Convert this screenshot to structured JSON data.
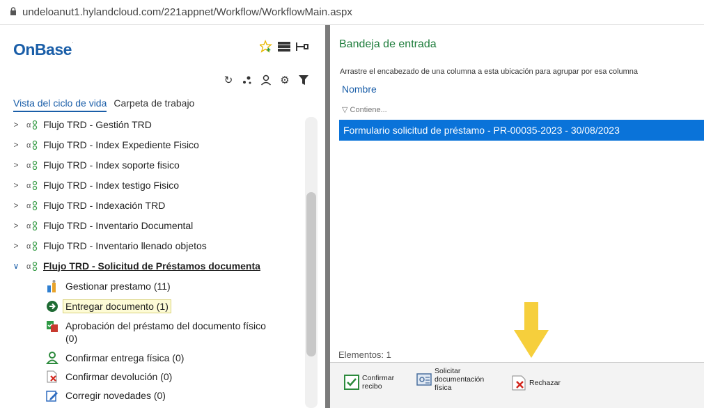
{
  "browser": {
    "url": "undeloanut1.hylandcloud.com/221appnet/Workflow/WorkflowMain.aspx"
  },
  "left": {
    "logo": "OnBase",
    "top_icons": [
      "star-add-icon",
      "layout-icon",
      "pin-icon"
    ],
    "tool_icons": [
      "refresh-icon",
      "dots-icon",
      "user-icon",
      "gear-icon",
      "filter-icon"
    ],
    "tabs": [
      {
        "label": "Vista del ciclo de vida",
        "active": true
      },
      {
        "label": "Carpeta de trabajo",
        "active": false
      }
    ],
    "tree": [
      {
        "label": "Flujo TRD - Gestión TRD"
      },
      {
        "label": "Flujo TRD - Index Expediente Fisico"
      },
      {
        "label": "Flujo TRD - Index soporte fisico"
      },
      {
        "label": "Flujo TRD - Index testigo Fisico"
      },
      {
        "label": "Flujo TRD - Indexación TRD"
      },
      {
        "label": "Flujo TRD - Inventario Documental"
      },
      {
        "label": "Flujo TRD - Inventario llenado objetos"
      },
      {
        "label": "Flujo TRD - Solicitud de Préstamos documenta"
      }
    ],
    "children": [
      {
        "label": "Gestionar prestamo (11)",
        "icon": "user-queue-icon"
      },
      {
        "label": "Entregar documento (1)",
        "icon": "arrow-circle-icon",
        "selected": true
      },
      {
        "label": "Aprobación del préstamo del documento físico\n(0)",
        "icon": "approval-icon"
      },
      {
        "label": "Confirmar entrega física (0)",
        "icon": "person-icon"
      },
      {
        "label": "Confirmar devolución (0)",
        "icon": "return-icon"
      },
      {
        "label": "Corregir novedades (0)",
        "icon": "edit-icon"
      }
    ]
  },
  "right": {
    "title": "Bandeja de entrada",
    "group_hint": "Arrastre el encabezado de una columna a esta ubicación para agrupar por esa columna",
    "column": "Nombre",
    "filter_placeholder": "Contiene...",
    "rows": [
      "Formulario solicitud de préstamo - PR-00035-2023 - 30/08/2023"
    ],
    "count": "Elementos: 1",
    "toolbar": {
      "confirm": "Confirmar\nrecibo",
      "request": "Solicitar\ndocumentación\nfísica",
      "reject": "Rechazar"
    }
  },
  "colors": {
    "accent_blue": "#1a5ea8",
    "selection": "#0a73d9",
    "title_green": "#1c7c3a",
    "annotation_arrow": "#f6cf3c"
  }
}
